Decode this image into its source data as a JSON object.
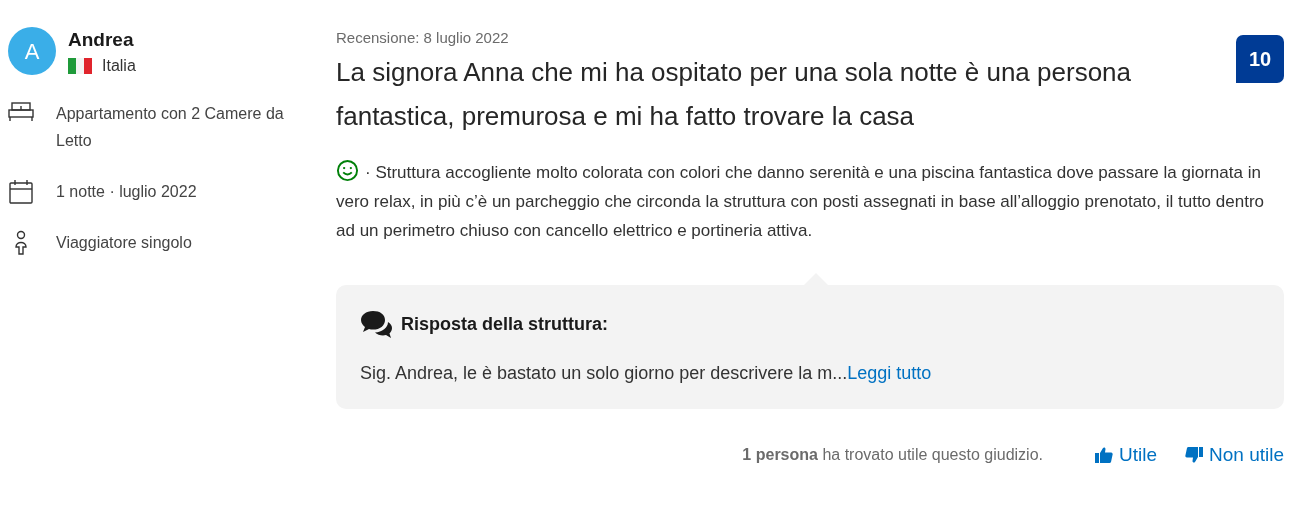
{
  "reviewer": {
    "initial": "A",
    "name": "Andrea",
    "country": "Italia"
  },
  "details": [
    {
      "kind": "room",
      "text": "Appartamento con 2 Camere da Letto"
    },
    {
      "kind": "stay",
      "text": "1 notte ·  luglio 2022"
    },
    {
      "kind": "traveler",
      "text": "Viaggiatore singolo"
    }
  ],
  "review": {
    "date": "Recensione: 8 luglio 2022",
    "title": "La signora Anna che mi ha ospitato per una sola notte è una persona fantastica, premurosa e mi ha fatto trovare la casa",
    "score": "10",
    "positive": "· Struttura accogliente molto colorata con colori che danno serenità e una piscina fantastica dove passare la giornata in vero relax, in più c’è un parcheggio che circonda la struttura con posti assegnati in base all’alloggio prenotato, il tutto dentro ad un perimetro chiuso con cancello elettrico e portineria attiva."
  },
  "response": {
    "heading": "Risposta della struttura:",
    "text": "Sig. Andrea, le è bastato un solo giorno per descrivere la m...",
    "link": "Leggi tutto"
  },
  "helpful": {
    "text": "**1 persona** ha trovato utile questo giudizio.",
    "buttons": [
      {
        "kind": "up",
        "label": "Utile"
      },
      {
        "kind": "down",
        "label": "Non utile"
      }
    ]
  }
}
